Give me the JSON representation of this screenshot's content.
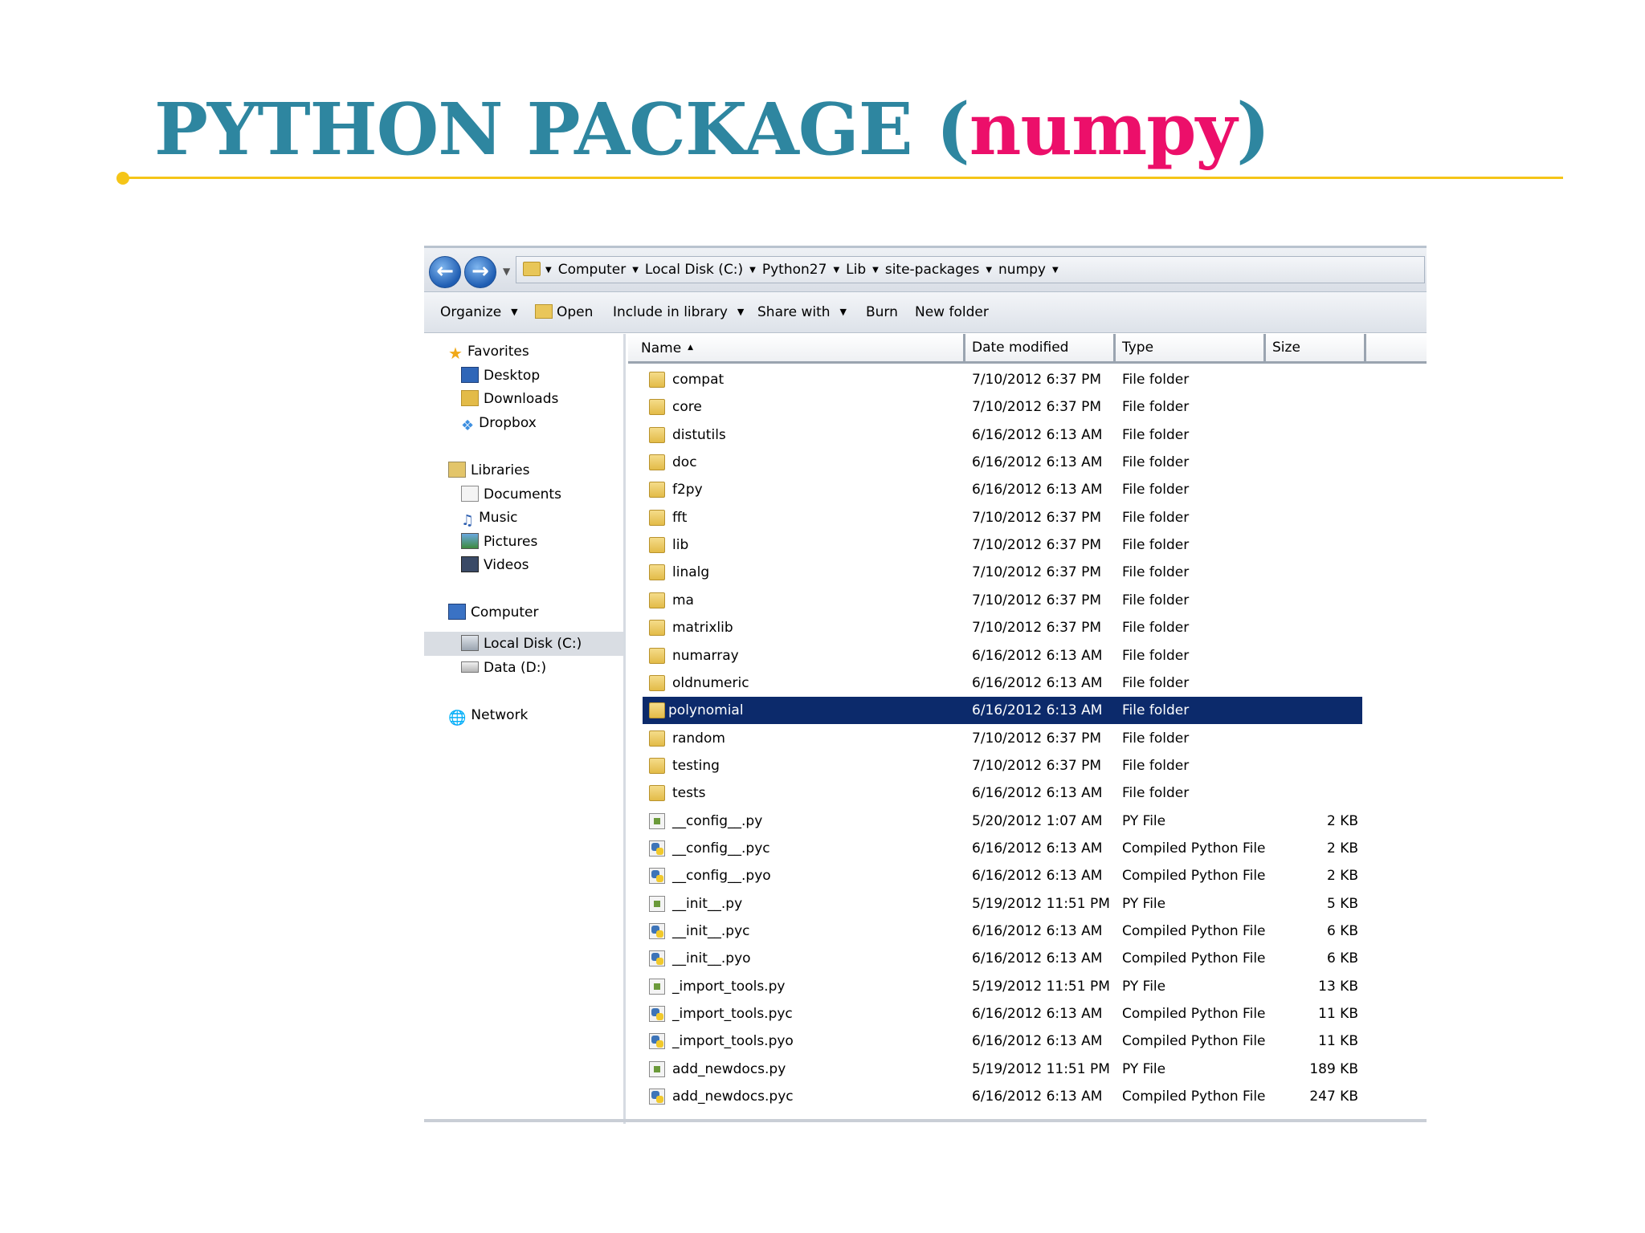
{
  "slide": {
    "title_main": "PYTHON PACKAGE (",
    "title_highlight": "numpy",
    "title_close": ")"
  },
  "explorer": {
    "breadcrumbs": [
      "Computer",
      "Local Disk (C:)",
      "Python27",
      "Lib",
      "site-packages",
      "numpy"
    ],
    "toolbar": {
      "organize": "Organize",
      "open": "Open",
      "include_in_library": "Include in library",
      "share_with": "Share with",
      "burn": "Burn",
      "new_folder": "New folder"
    },
    "nav": {
      "favorites": "Favorites",
      "desktop": "Desktop",
      "downloads": "Downloads",
      "dropbox": "Dropbox",
      "libraries": "Libraries",
      "documents": "Documents",
      "music": "Music",
      "pictures": "Pictures",
      "videos": "Videos",
      "computer": "Computer",
      "local_disk": "Local Disk (C:)",
      "data_disk": "Data (D:)",
      "network": "Network"
    },
    "columns": {
      "name": "Name",
      "date_modified": "Date modified",
      "type": "Type",
      "size": "Size"
    },
    "selected_index": 12,
    "files": [
      {
        "name": "compat",
        "date": "7/10/2012 6:37 PM",
        "type": "File folder",
        "size": "",
        "icon": "folder-icon"
      },
      {
        "name": "core",
        "date": "7/10/2012 6:37 PM",
        "type": "File folder",
        "size": "",
        "icon": "folder-icon"
      },
      {
        "name": "distutils",
        "date": "6/16/2012 6:13 AM",
        "type": "File folder",
        "size": "",
        "icon": "folder-icon"
      },
      {
        "name": "doc",
        "date": "6/16/2012 6:13 AM",
        "type": "File folder",
        "size": "",
        "icon": "folder-icon"
      },
      {
        "name": "f2py",
        "date": "6/16/2012 6:13 AM",
        "type": "File folder",
        "size": "",
        "icon": "folder-icon"
      },
      {
        "name": "fft",
        "date": "7/10/2012 6:37 PM",
        "type": "File folder",
        "size": "",
        "icon": "folder-icon"
      },
      {
        "name": "lib",
        "date": "7/10/2012 6:37 PM",
        "type": "File folder",
        "size": "",
        "icon": "folder-icon"
      },
      {
        "name": "linalg",
        "date": "7/10/2012 6:37 PM",
        "type": "File folder",
        "size": "",
        "icon": "folder-icon"
      },
      {
        "name": "ma",
        "date": "7/10/2012 6:37 PM",
        "type": "File folder",
        "size": "",
        "icon": "folder-icon"
      },
      {
        "name": "matrixlib",
        "date": "7/10/2012 6:37 PM",
        "type": "File folder",
        "size": "",
        "icon": "folder-icon"
      },
      {
        "name": "numarray",
        "date": "6/16/2012 6:13 AM",
        "type": "File folder",
        "size": "",
        "icon": "folder-icon"
      },
      {
        "name": "oldnumeric",
        "date": "6/16/2012 6:13 AM",
        "type": "File folder",
        "size": "",
        "icon": "folder-icon"
      },
      {
        "name": "polynomial",
        "date": "6/16/2012 6:13 AM",
        "type": "File folder",
        "size": "",
        "icon": "folder-icon"
      },
      {
        "name": "random",
        "date": "7/10/2012 6:37 PM",
        "type": "File folder",
        "size": "",
        "icon": "folder-icon"
      },
      {
        "name": "testing",
        "date": "7/10/2012 6:37 PM",
        "type": "File folder",
        "size": "",
        "icon": "folder-icon"
      },
      {
        "name": "tests",
        "date": "6/16/2012 6:13 AM",
        "type": "File folder",
        "size": "",
        "icon": "folder-icon"
      },
      {
        "name": "__config__.py",
        "date": "5/20/2012 1:07 AM",
        "type": "PY File",
        "size": "2 KB",
        "icon": "python-file-icon"
      },
      {
        "name": "__config__.pyc",
        "date": "6/16/2012 6:13 AM",
        "type": "Compiled Python File",
        "size": "2 KB",
        "icon": "compiled-python-icon"
      },
      {
        "name": "__config__.pyo",
        "date": "6/16/2012 6:13 AM",
        "type": "Compiled Python File",
        "size": "2 KB",
        "icon": "compiled-python-icon"
      },
      {
        "name": "__init__.py",
        "date": "5/19/2012 11:51 PM",
        "type": "PY File",
        "size": "5 KB",
        "icon": "python-file-icon"
      },
      {
        "name": "__init__.pyc",
        "date": "6/16/2012 6:13 AM",
        "type": "Compiled Python File",
        "size": "6 KB",
        "icon": "compiled-python-icon"
      },
      {
        "name": "__init__.pyo",
        "date": "6/16/2012 6:13 AM",
        "type": "Compiled Python File",
        "size": "6 KB",
        "icon": "compiled-python-icon"
      },
      {
        "name": "_import_tools.py",
        "date": "5/19/2012 11:51 PM",
        "type": "PY File",
        "size": "13 KB",
        "icon": "python-file-icon"
      },
      {
        "name": "_import_tools.pyc",
        "date": "6/16/2012 6:13 AM",
        "type": "Compiled Python File",
        "size": "11 KB",
        "icon": "compiled-python-icon"
      },
      {
        "name": "_import_tools.pyo",
        "date": "6/16/2012 6:13 AM",
        "type": "Compiled Python File",
        "size": "11 KB",
        "icon": "compiled-python-icon"
      },
      {
        "name": "add_newdocs.py",
        "date": "5/19/2012 11:51 PM",
        "type": "PY File",
        "size": "189 KB",
        "icon": "python-file-icon"
      },
      {
        "name": "add_newdocs.pyc",
        "date": "6/16/2012 6:13 AM",
        "type": "Compiled Python File",
        "size": "247 KB",
        "icon": "compiled-python-icon"
      }
    ]
  }
}
